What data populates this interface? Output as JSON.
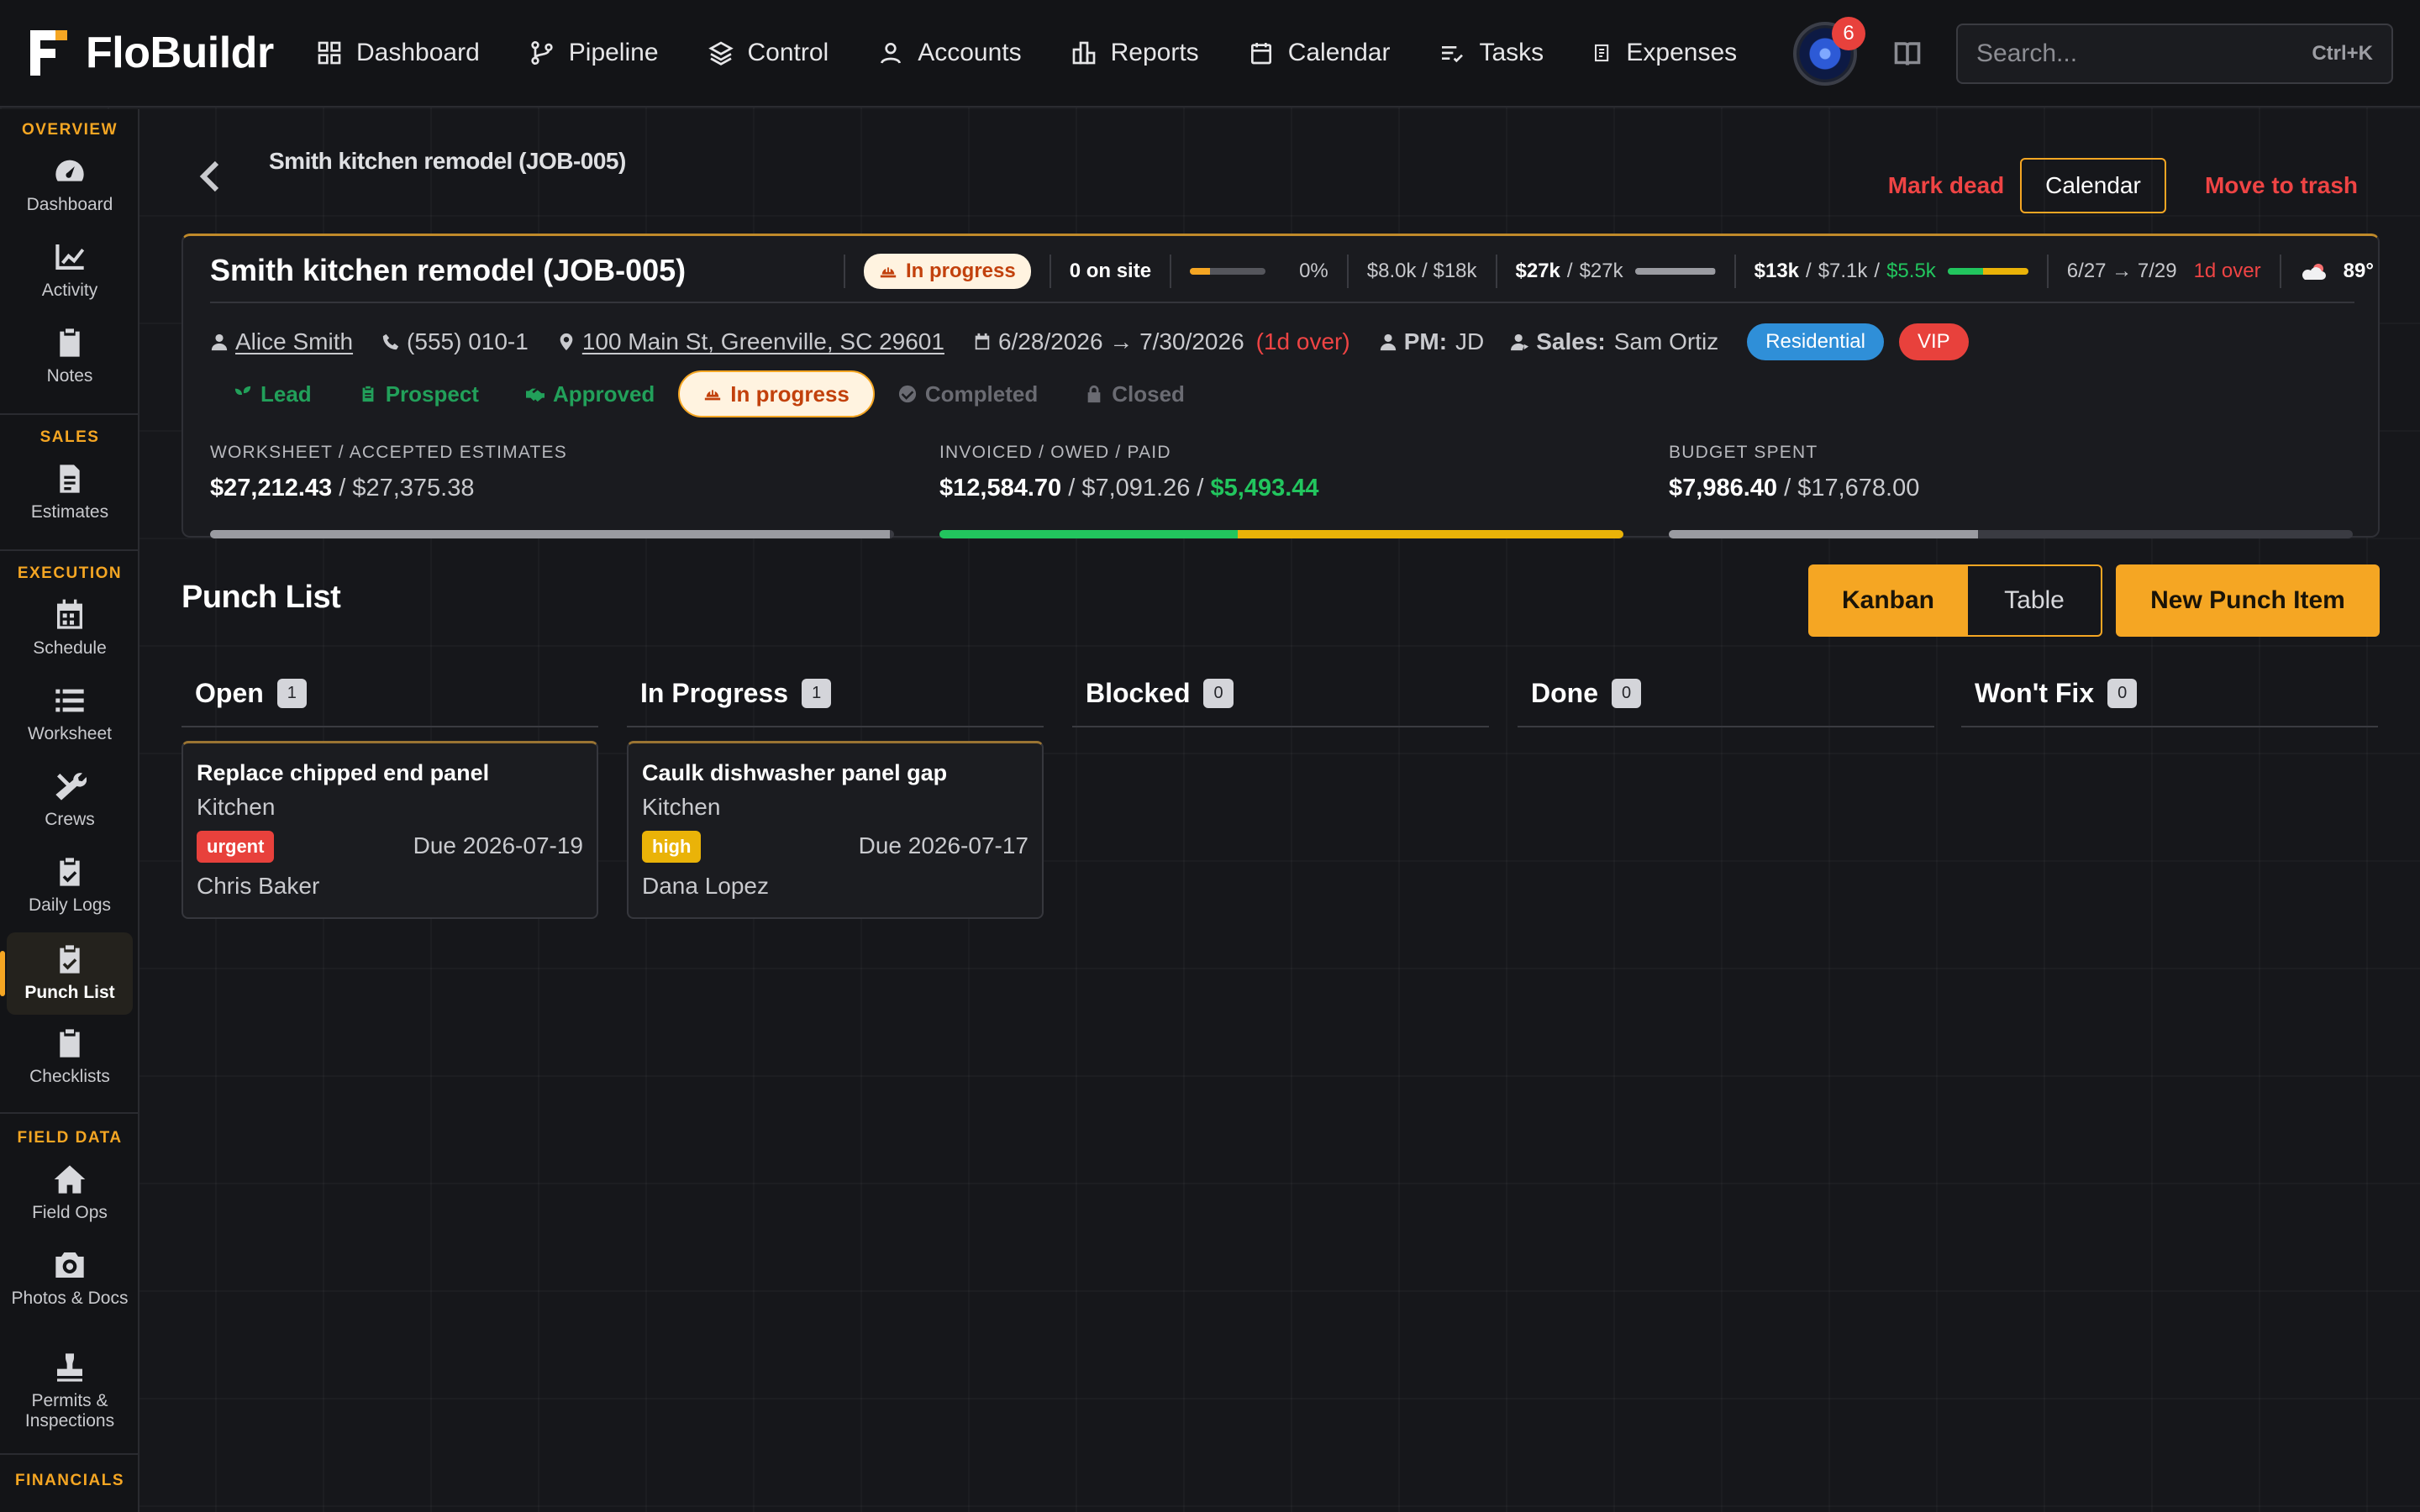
{
  "app": {
    "name": "FloBuildr"
  },
  "nav": {
    "items": [
      {
        "label": "Dashboard"
      },
      {
        "label": "Pipeline"
      },
      {
        "label": "Control"
      },
      {
        "label": "Accounts"
      },
      {
        "label": "Reports"
      },
      {
        "label": "Calendar"
      },
      {
        "label": "Tasks"
      },
      {
        "label": "Expenses"
      }
    ],
    "notification_count": "6",
    "search": {
      "placeholder": "Search...",
      "shortcut": "Ctrl+K"
    }
  },
  "sidebar": {
    "sections": [
      "OVERVIEW",
      "SALES",
      "EXECUTION",
      "FIELD DATA",
      "FINANCIALS"
    ],
    "items": [
      {
        "label": "Dashboard",
        "icon": "gauge-icon"
      },
      {
        "label": "Activity",
        "icon": "chart-line-icon"
      },
      {
        "label": "Notes",
        "icon": "clipboard-icon"
      },
      {
        "label": "Estimates",
        "icon": "document-icon"
      },
      {
        "label": "Schedule",
        "icon": "calendar-icon"
      },
      {
        "label": "Worksheet",
        "icon": "list-icon"
      },
      {
        "label": "Crews",
        "icon": "tools-icon"
      },
      {
        "label": "Daily Logs",
        "icon": "clipboard-check-icon"
      },
      {
        "label": "Punch List",
        "icon": "clipboard-check-icon",
        "active": true
      },
      {
        "label": "Checklists",
        "icon": "clipboard-icon"
      },
      {
        "label": "Field Ops",
        "icon": "house-icon"
      },
      {
        "label": "Photos & Docs",
        "icon": "camera-icon"
      },
      {
        "label": "Permits & Inspections",
        "icon": "stamp-icon"
      }
    ]
  },
  "header": {
    "crumb": "Smith kitchen remodel (JOB-005)",
    "mark_dead": "Mark dead",
    "calendar": "Calendar",
    "trash": "Move to trash"
  },
  "job": {
    "title": "Smith kitchen remodel (JOB-005)",
    "status": "In progress",
    "on_site": "0 on site",
    "progress_pct": "0%",
    "budget_short": "$8.0k / $18k",
    "worksheet_short_a": "$27k",
    "worksheet_short_b": "$27k",
    "invoice_short_a": "$13k",
    "invoice_short_b": "$7.1k",
    "invoice_short_c": "$5.5k",
    "dates_short": "6/27 → 7/29",
    "over_short": "1d over",
    "weather": "89°",
    "client": "Alice Smith",
    "phone": "(555) 010-1",
    "address": "100 Main St, Greenville, SC 29601",
    "date_range": "6/28/2026 → 7/30/2026",
    "over": "(1d over)",
    "pm_label": "PM:",
    "pm": "JD",
    "sales_label": "Sales:",
    "sales": "Sam Ortiz",
    "tags": [
      "Residential",
      "VIP"
    ],
    "stages": [
      "Lead",
      "Prospect",
      "Approved",
      "In progress",
      "Completed",
      "Closed"
    ],
    "metrics": {
      "worksheet": {
        "label": "WORKSHEET / ACCEPTED ESTIMATES",
        "a": "$27,212.43",
        "b": "$27,375.38",
        "fraction": 0.994
      },
      "invoiced": {
        "label": "INVOICED / OWED / PAID",
        "a": "$12,584.70",
        "b": "$7,091.26",
        "c": "$5,493.44",
        "paid_fraction": 0.436
      },
      "budget": {
        "label": "BUDGET SPENT",
        "a": "$7,986.40",
        "b": "$17,678.00",
        "fraction": 0.452
      }
    }
  },
  "punch": {
    "title": "Punch List",
    "view_kanban": "Kanban",
    "view_table": "Table",
    "new_button": "New Punch Item",
    "columns": [
      {
        "name": "Open",
        "count": "1"
      },
      {
        "name": "In Progress",
        "count": "1"
      },
      {
        "name": "Blocked",
        "count": "0"
      },
      {
        "name": "Done",
        "count": "0"
      },
      {
        "name": "Won't Fix",
        "count": "0"
      }
    ],
    "cards": [
      {
        "title": "Replace chipped end panel",
        "location": "Kitchen",
        "priority": "urgent",
        "due": "Due 2026-07-19",
        "assignee": "Chris Baker"
      },
      {
        "title": "Caulk dishwasher panel gap",
        "location": "Kitchen",
        "priority": "high",
        "due": "Due 2026-07-17",
        "assignee": "Dana Lopez"
      }
    ]
  },
  "colors": {
    "accent": "#f5a623",
    "danger": "#ef4444",
    "success": "#22c55e",
    "residential": "#2f8fd8",
    "vip": "#e8413c"
  }
}
